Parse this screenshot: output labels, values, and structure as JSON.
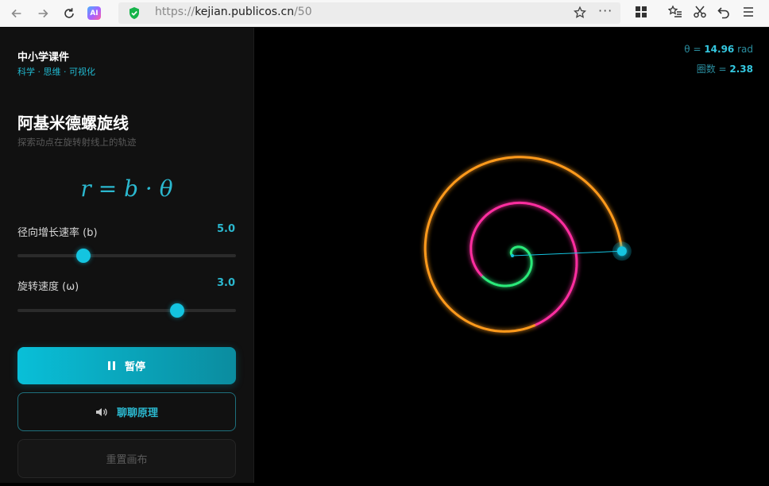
{
  "browser": {
    "url_prefix": "https://",
    "url_host": "kejian.publicos.cn",
    "url_path": "/50",
    "ai_label": "AI",
    "more_label": "···"
  },
  "sidebar": {
    "brand_title": "中小学课件",
    "brand_tags": "科学 · 思维 · 可视化",
    "page_title": "阿基米德螺旋线",
    "page_subtitle": "探索动点在旋转射线上的轨迹",
    "formula": "r = b · θ",
    "params": [
      {
        "label": "径向增长速率 (b)",
        "value": "5.0",
        "level": 0.3
      },
      {
        "label": "旋转速度 (ω)",
        "value": "3.0",
        "level": 0.73
      }
    ],
    "buttons": {
      "pause": "暂停",
      "talk": "聊聊原理",
      "reset": "重置画布"
    }
  },
  "canvas": {
    "theta_label": "θ = ",
    "theta_value": "14.96",
    "theta_unit": " rad",
    "turns_label": "圈数 = ",
    "turns_value": "2.38",
    "colors": {
      "accent": "#14c4e0",
      "spiral_inner": "#2bea7a",
      "spiral_mid": "#ff2fa0",
      "spiral_outer": "#ff9a1a"
    }
  }
}
